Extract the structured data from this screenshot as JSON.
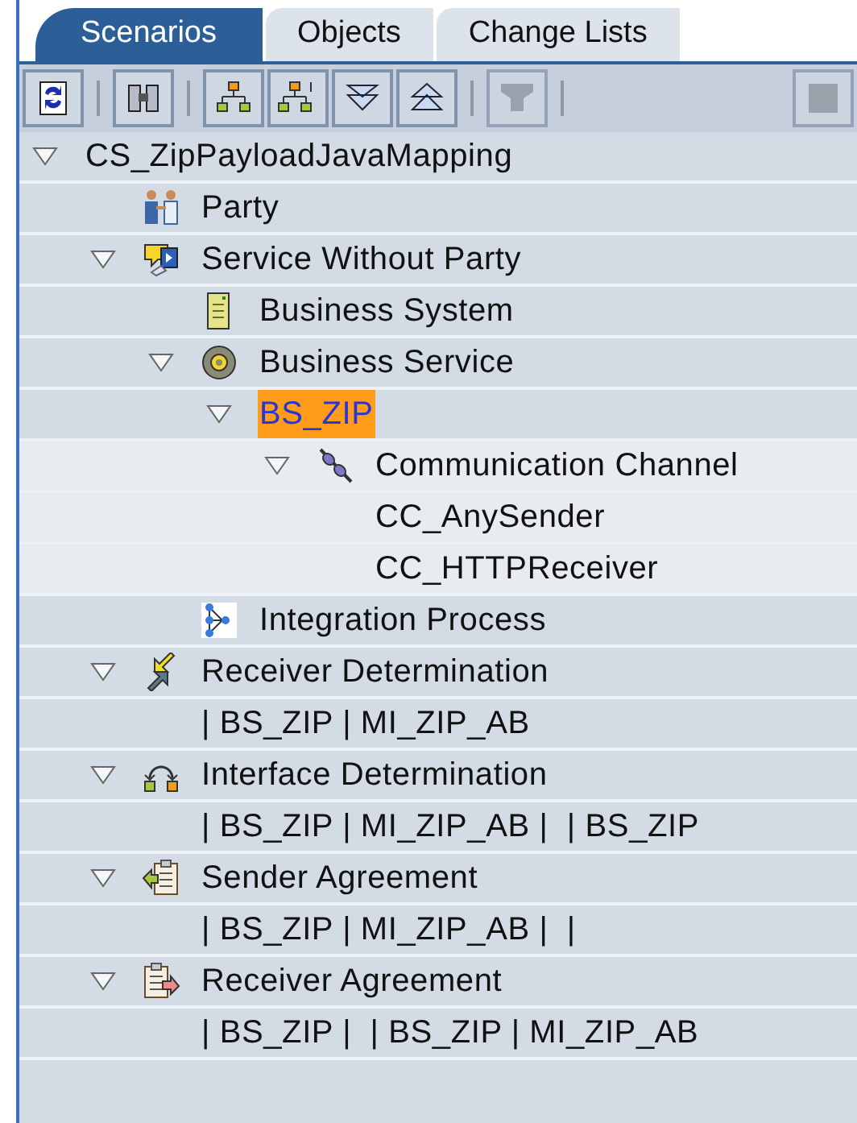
{
  "tabs": [
    {
      "label": "Scenarios",
      "selected": true
    },
    {
      "label": "Objects",
      "selected": false
    },
    {
      "label": "Change Lists",
      "selected": false
    }
  ],
  "toolbar": [
    {
      "kind": "refresh",
      "disabled": false
    },
    {
      "kind": "separator"
    },
    {
      "kind": "find",
      "disabled": false
    },
    {
      "kind": "separator"
    },
    {
      "kind": "expand",
      "disabled": false
    },
    {
      "kind": "collapse",
      "disabled": false
    },
    {
      "kind": "expand_all",
      "disabled": false
    },
    {
      "kind": "collapse_all",
      "disabled": false
    },
    {
      "kind": "separator"
    },
    {
      "kind": "filter",
      "disabled": true
    },
    {
      "kind": "separator"
    },
    {
      "kind": "stop",
      "disabled": true
    }
  ],
  "tree": [
    {
      "label": "CS_ZipPayloadJavaMapping",
      "expanded": true,
      "selected": false,
      "children": [
        {
          "label": "Party",
          "kind": "party",
          "selected": false
        },
        {
          "label": "Service Without Party",
          "kind": "service",
          "expanded": true,
          "selected": false,
          "children": [
            {
              "label": "Business System",
              "kind": "system",
              "selected": false
            },
            {
              "label": "Business Service",
              "kind": "business_service",
              "expanded": true,
              "selected": false,
              "children": [
                {
                  "label": "BS_ZIP",
                  "expanded": true,
                  "selected": true,
                  "children": [
                    {
                      "label": "Communication Channel",
                      "kind": "channel",
                      "expanded": true,
                      "selected": false,
                      "children": [
                        {
                          "label": "CC_AnySender",
                          "selected": false
                        },
                        {
                          "label": "CC_HTTPReceiver",
                          "selected": false
                        }
                      ]
                    }
                  ]
                }
              ]
            },
            {
              "label": "Integration Process",
              "kind": "process",
              "selected": false
            }
          ]
        },
        {
          "label": "Receiver Determination",
          "kind": "receiver_determination",
          "expanded": true,
          "selected": false,
          "children": [
            {
              "label": "| BS_ZIP | MI_ZIP_AB",
              "selected": false
            }
          ]
        },
        {
          "label": "Interface Determination",
          "kind": "interface_determination",
          "expanded": true,
          "selected": false,
          "children": [
            {
              "label": "| BS_ZIP | MI_ZIP_AB |  | BS_ZIP",
              "selected": false
            }
          ]
        },
        {
          "label": "Sender Agreement",
          "kind": "sender_agreement",
          "expanded": true,
          "selected": false,
          "children": [
            {
              "label": "| BS_ZIP | MI_ZIP_AB |  |",
              "selected": false
            }
          ]
        },
        {
          "label": "Receiver Agreement",
          "kind": "receiver_agreement",
          "expanded": true,
          "selected": false,
          "children": [
            {
              "label": "| BS_ZIP |  | BS_ZIP | MI_ZIP_AB",
              "selected": false
            }
          ]
        }
      ]
    }
  ]
}
